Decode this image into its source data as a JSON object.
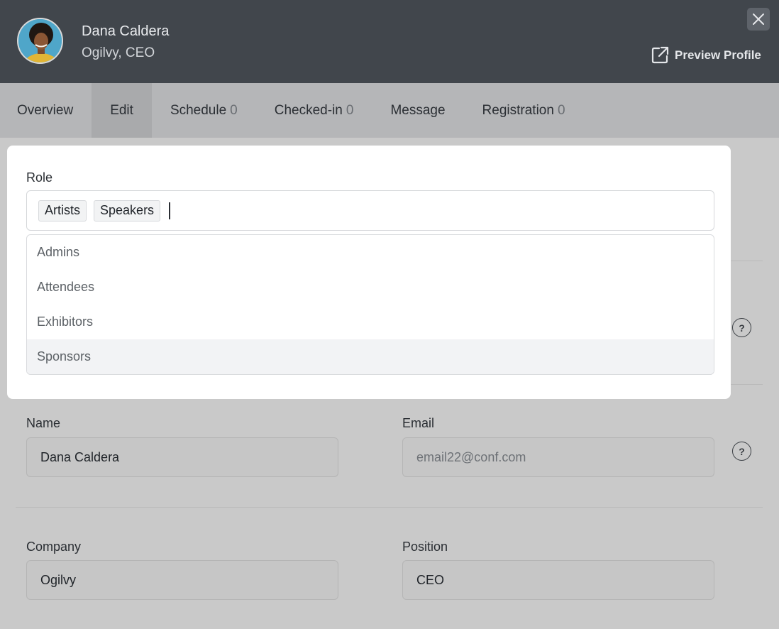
{
  "profile": {
    "name": "Dana Caldera",
    "subtitle": "Ogilvy, CEO",
    "preview_label": "Preview Profile"
  },
  "tabs": [
    {
      "label": "Overview",
      "count": ""
    },
    {
      "label": "Edit",
      "count": ""
    },
    {
      "label": "Schedule",
      "count": "0"
    },
    {
      "label": "Checked-in",
      "count": "0"
    },
    {
      "label": "Message",
      "count": ""
    },
    {
      "label": "Registration",
      "count": "0"
    }
  ],
  "active_tab": "Edit",
  "role": {
    "label": "Role",
    "selected": [
      "Artists",
      "Speakers"
    ],
    "options": [
      "Admins",
      "Attendees",
      "Exhibitors",
      "Sponsors"
    ],
    "highlighted": "Sponsors"
  },
  "form": {
    "name_label": "Name",
    "name_value": "Dana Caldera",
    "email_label": "Email",
    "email_placeholder": "email22@conf.com",
    "company_label": "Company",
    "company_value": "Ogilvy",
    "position_label": "Position",
    "position_value": "CEO",
    "help_glyph": "?"
  },
  "colors": {
    "header_bg": "#41464c",
    "overlay": "#c9c9c9",
    "panel": "#ffffff"
  },
  "icons": {
    "close": "close-icon",
    "external_link": "external-link-icon",
    "help": "help-icon"
  }
}
